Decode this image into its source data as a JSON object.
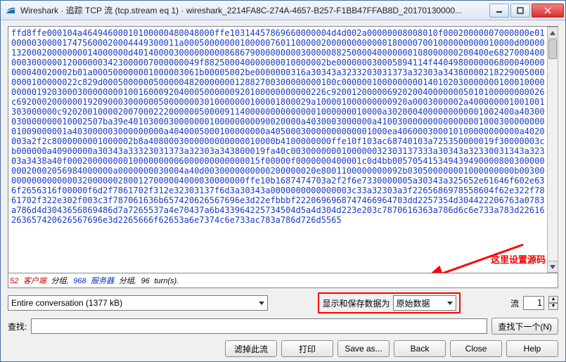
{
  "window": {
    "title": "Wireshark · 追踪 TCP 流 (tcp.stream eq 1) · wireshark_2214FA8C-274A-4657-B257-F1BB47FFAB8D_20170130000..."
  },
  "hex": "ffd8ffe000104a46494600010100000480048000ffe10314457869660000004d4d002a00000008008010f00020000007000000e01000003000017475600020004449300011a00050000000100000760110000020000000000001800007001000000000010000d0000013200020000000014000000d4014000030000000008686790000000003000008825000040000000108000000200400e68270004000003000000120000003423000007000000049f882500040000000010000002be000000030005894114f4404980000006800040000000040020002b01a000500000001000003061b00005002be0000000316a30343a3233203031373a32303a343800002182290050000000100000022c829d0005000000500000482000000012882700300000000100c000000100000000014010203000000010001000000000192030003000000001001600092040005000000920100000000000226c920012000006920200400000005010100000000026c6920002000000192090003000000500000003010000000100001800029a100001000000000920a0003000002a400000001001001303000000c920200100002007000222000000500009114000000000000001000000010000a3020004000000000001002400a40300030000000010002507ba39e4010300030000000100000000090020000a4030003000000a41003000000000000000100030000000001009000001a403000003000000000a4040005000100000000a40500030000000000001000ea406000300010100000000000a4020003a2f2c8000000001000002b8a4080003000000000000010000b4100000000ffe10f103ac68740103a725350000019f30000003cb000000a40900000a30343a33323031373a32303a343800019fa40c0030000000100000032303137333a30343a32330031343a32303a3438a40f00020000000010000000006000000000000015f00000f0000000400001c0d4bb00570541534943949000080030000000020002056984000000a0000000030004a40d0030000000000200000020e8001100000000092b030500000001000000000b003000000000000000320000002800127000004000030000000ffe10b1687474703a2f2f6e7330000005a30343a325652e61646f602e636f2656316f00000f6d2f7861702f312e32303137f6d3a30343a0000000000000003c33a32303a3f2265686978558604f62e322f7861702f322e302f003c3f787061636b657420626567696e3d22efbbbf2220696968747466964703dd2257354d304422206763a0783a786d4d3043656869486d7a7265537a4e70437a6b433964225734504d5a4d304d223e203c7870616363a786d6c6e733a783d22616263657420626567696e3d2265666f62653a6e7374c6e733ac783a786d726d5565",
  "status": {
    "client_pkts": "52",
    "client_label": "客户端",
    "sep1": "分组,",
    "server_pkts": "968",
    "server_label": "服务器",
    "sep2": "分组,",
    "turns": "96",
    "turns_label": "turn(s)."
  },
  "conversation": {
    "selected": "Entire conversation (1377 kB)"
  },
  "display_save": {
    "label": "显示和保存数据为",
    "selected": "原始数据"
  },
  "stream": {
    "label": "流",
    "value": "1"
  },
  "find": {
    "label": "查找:",
    "button": "查找下一个(N)"
  },
  "buttons": {
    "filter": "滤掉此流",
    "print": "打印",
    "saveas": "Save as...",
    "back": "Back",
    "close": "Close",
    "help": "Help"
  },
  "annotation": "这里设置源码"
}
